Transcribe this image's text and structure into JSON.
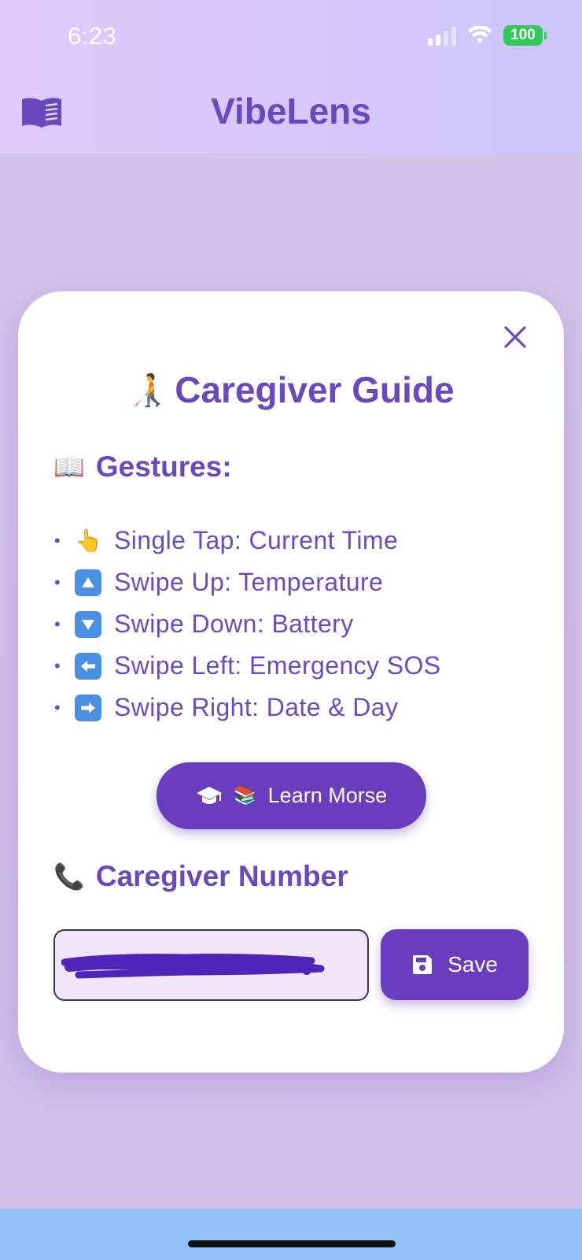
{
  "status_bar": {
    "time": "6:23",
    "battery": "100"
  },
  "header": {
    "title": "VibeLens",
    "menu_icon": "book-icon"
  },
  "modal": {
    "title": "Caregiver Guide",
    "title_emoji": "🧑‍🦯",
    "close_icon": "close-icon",
    "gestures_heading": "Gestures:",
    "gestures_emoji": "📖",
    "gestures": [
      {
        "icon": "👆",
        "text": "Single Tap: Current Time"
      },
      {
        "icon": "up-arrow-icon",
        "text": "Swipe Up: Temperature"
      },
      {
        "icon": "down-arrow-icon",
        "text": "Swipe Down: Battery"
      },
      {
        "icon": "left-arrow-icon",
        "text": "Swipe Left: Emergency SOS"
      },
      {
        "icon": "right-arrow-icon",
        "text": "Swipe Right: Date & Day"
      }
    ],
    "learn_button": {
      "label": "Learn Morse",
      "emoji": "📚",
      "icon": "graduation-cap-icon"
    },
    "caregiver_heading": "Caregiver Number",
    "caregiver_emoji": "📞",
    "phone_input": {
      "value": "",
      "placeholder": ""
    },
    "save_button": {
      "label": "Save",
      "icon": "floppy-disk-icon"
    }
  },
  "colors": {
    "accent": "#6a3dbe",
    "title_text": "#6a48be",
    "input_bg": "#f2e5f7",
    "bottom_bar": "#93c2fa"
  }
}
